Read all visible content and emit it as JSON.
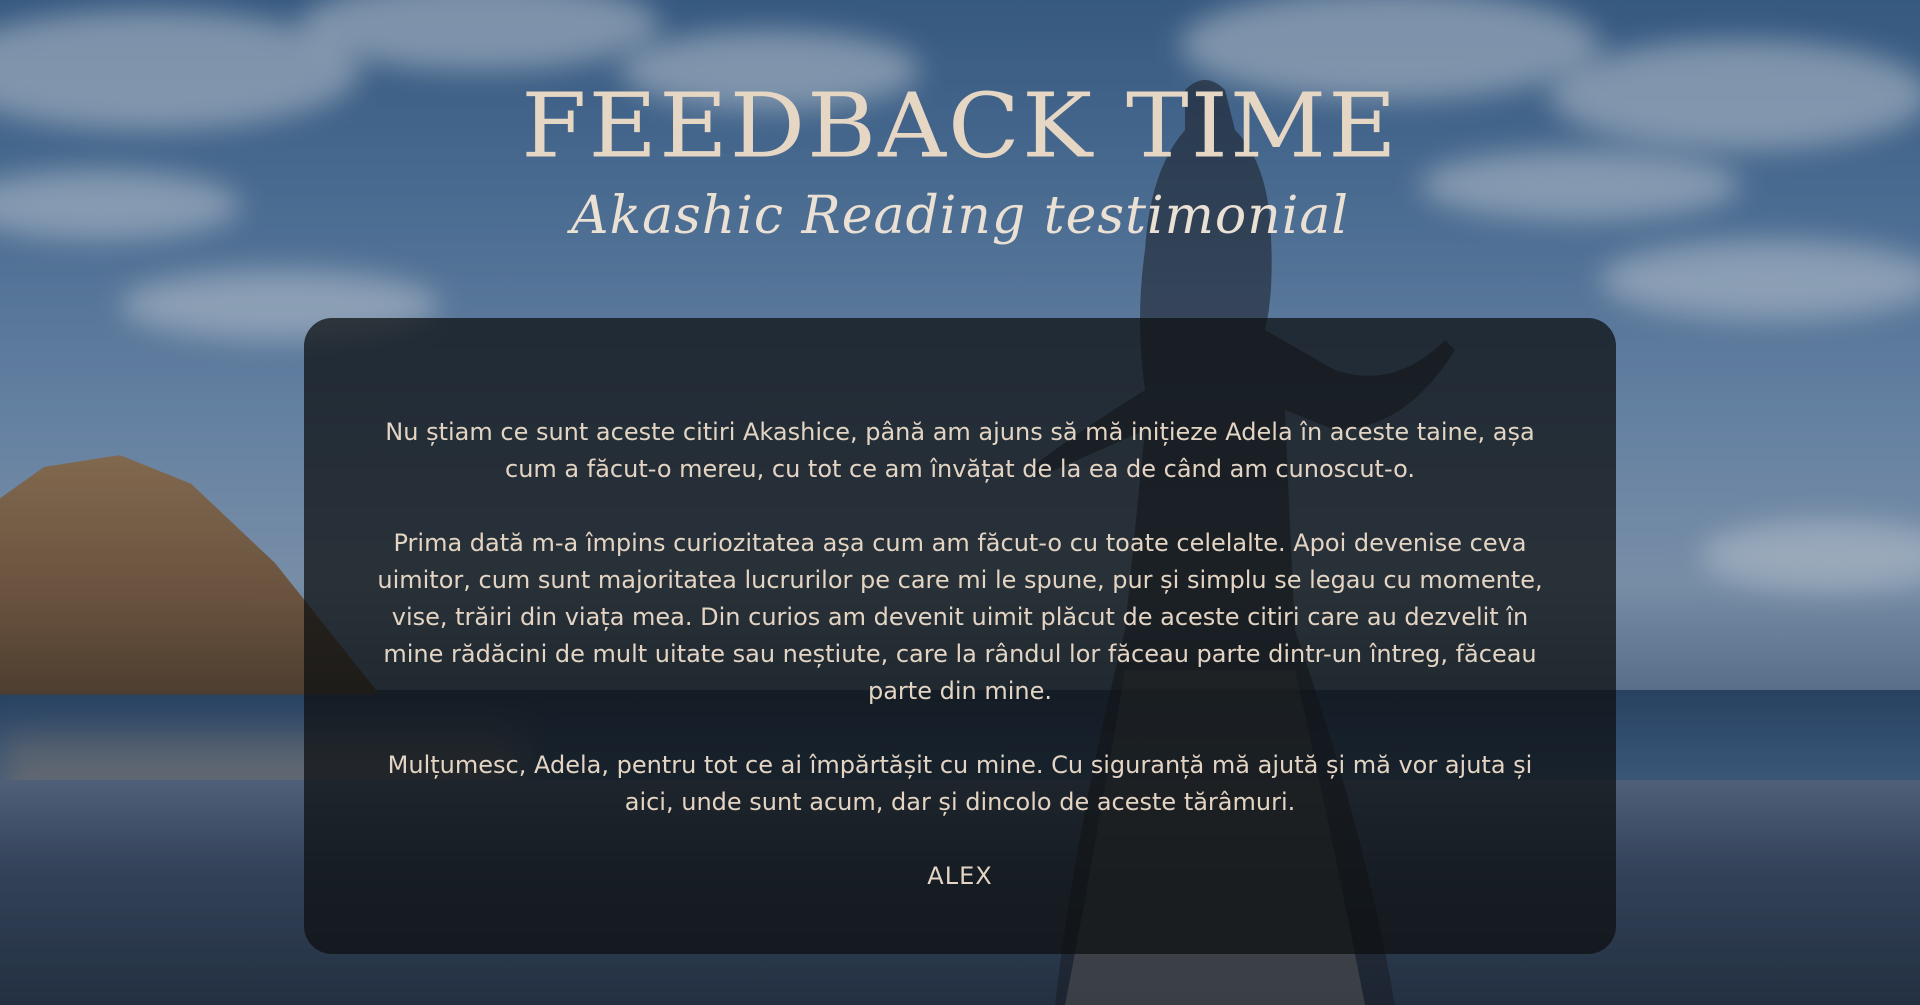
{
  "header": {
    "title": "FEEDBACK TIME",
    "subtitle": "Akashic Reading testimonial"
  },
  "testimonial": {
    "paragraphs": [
      "Nu știam ce sunt aceste citiri Akashice, până am ajuns să mă inițieze Adela în aceste taine, așa cum a făcut-o mereu, cu tot ce am învățat de la ea de când am cunoscut-o.",
      "Prima dată m-a împins curiozitatea așa cum am făcut-o cu toate celelalte. Apoi devenise ceva uimitor, cum sunt majoritatea lucrurilor pe care mi le spune, pur și simplu se legau cu momente, vise, trăiri din viața mea. Din curios am devenit uimit plăcut de aceste citiri care au dezvelit în mine rădăcini de mult uitate sau neștiute, care la rândul lor făceau parte dintr-un întreg, făceau parte din mine.",
      "Mulțumesc, Adela, pentru tot ce ai împărtășit cu mine. Cu siguranță mă ajută și mă vor ajuta și aici, unde sunt acum, dar și dincolo de aceste tărâmuri."
    ],
    "author": "ALEX"
  },
  "colors": {
    "title": "#e6d6c4",
    "card_background": "rgba(14,16,18,0.74)",
    "card_text": "#e3d4c3"
  }
}
